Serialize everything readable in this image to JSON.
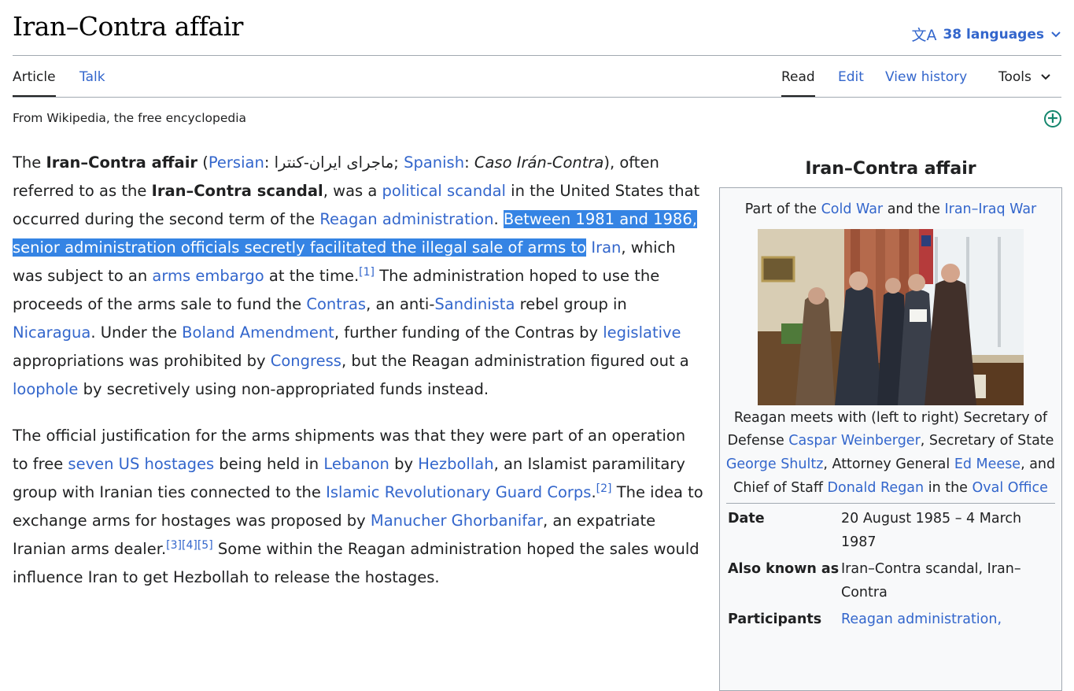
{
  "page": {
    "title": "Iran–Contra affair",
    "languages_label": "38 languages"
  },
  "tabs": {
    "article": "Article",
    "talk": "Talk",
    "read": "Read",
    "edit": "Edit",
    "view_history": "View history",
    "tools": "Tools"
  },
  "tagline": "From Wikipedia, the free encyclopedia",
  "p1": {
    "t1": "The ",
    "b1": "Iran–Contra affair",
    "t2": " (",
    "l_persian": "Persian",
    "t3": ": ",
    "persian_text": "ماجرای ایران-کنترا",
    "t4": "; ",
    "l_spanish": "Spanish",
    "t5": ": ",
    "i1": "Caso Irán-Contra",
    "t6": "), often referred to as the ",
    "b2": "Iran–Contra scandal",
    "t7": ", was a ",
    "l_political_scandal": "political scandal",
    "t8": " in the United States that occurred during the second term of the ",
    "l_reagan_admin": "Reagan administration",
    "t9": ". ",
    "selected": "Between 1981 and 1986, senior administration officials secretly facilitated the illegal sale of arms to",
    "t10": " ",
    "l_iran": "Iran",
    "t11": ", which was subject to an ",
    "l_arms_embargo": "arms embargo",
    "t12": " at the time.",
    "ref1": "[1]",
    "t13": " The administration hoped to use the proceeds of the arms sale to fund the ",
    "l_contras": "Contras",
    "t14": ", an anti-",
    "l_sandinista": "Sandinista",
    "t15": " rebel group in ",
    "l_nicaragua": "Nicaragua",
    "t16": ". Under the ",
    "l_boland": "Boland Amendment",
    "t17": ", further funding of the Contras by ",
    "l_legislative": "legislative",
    "t18": " appropriations was prohibited by ",
    "l_congress": "Congress",
    "t19": ", but the Reagan administration figured out a ",
    "l_loophole": "loophole",
    "t20": " by secretively using non-appropriated funds instead."
  },
  "p2": {
    "t1": "The official justification for the arms shipments was that they were part of an operation to free ",
    "l_hostages": "seven US hostages",
    "t2": " being held in ",
    "l_lebanon": "Lebanon",
    "t3": " by ",
    "l_hezbollah": "Hezbollah",
    "t4": ", an Islamist paramilitary group with Iranian ties connected to the ",
    "l_irgc": "Islamic Revolutionary Guard Corps",
    "t5": ".",
    "ref2": "[2]",
    "t6": " The idea to exchange arms for hostages was proposed by ",
    "l_ghorbanifar": "Manucher Ghorbanifar",
    "t7": ", an expatriate Iranian arms dealer.",
    "ref3": "[3]",
    "ref4": "[4]",
    "ref5": "[5]",
    "t8": " Some within the Reagan administration hoped the sales would influence Iran to get Hezbollah to release the hostages."
  },
  "infobox": {
    "title": "Iran–Contra affair",
    "sub_t1": "Part of the ",
    "l_cold_war": "Cold War",
    "sub_t2": " and the ",
    "l_iran_iraq_war": "Iran–Iraq War",
    "caption": {
      "t1": "Reagan meets with (left to right) Secretary of Defense ",
      "l_weinberger": "Caspar Weinberger",
      "t2": ", Secretary of State ",
      "l_shultz": "George Shultz",
      "t3": ", Attorney General ",
      "l_meese": "Ed Meese",
      "t4": ", and Chief of Staff ",
      "l_regan": "Donald Regan",
      "t5": " in the ",
      "l_oval": "Oval Office"
    },
    "rows": [
      {
        "label": "Date",
        "value": "20 August 1985 – 4 March 1987"
      },
      {
        "label": "Also known as",
        "value": "Iran–Contra scandal, Iran–Contra"
      },
      {
        "label": "Participants",
        "value": "Reagan administration,"
      }
    ]
  }
}
